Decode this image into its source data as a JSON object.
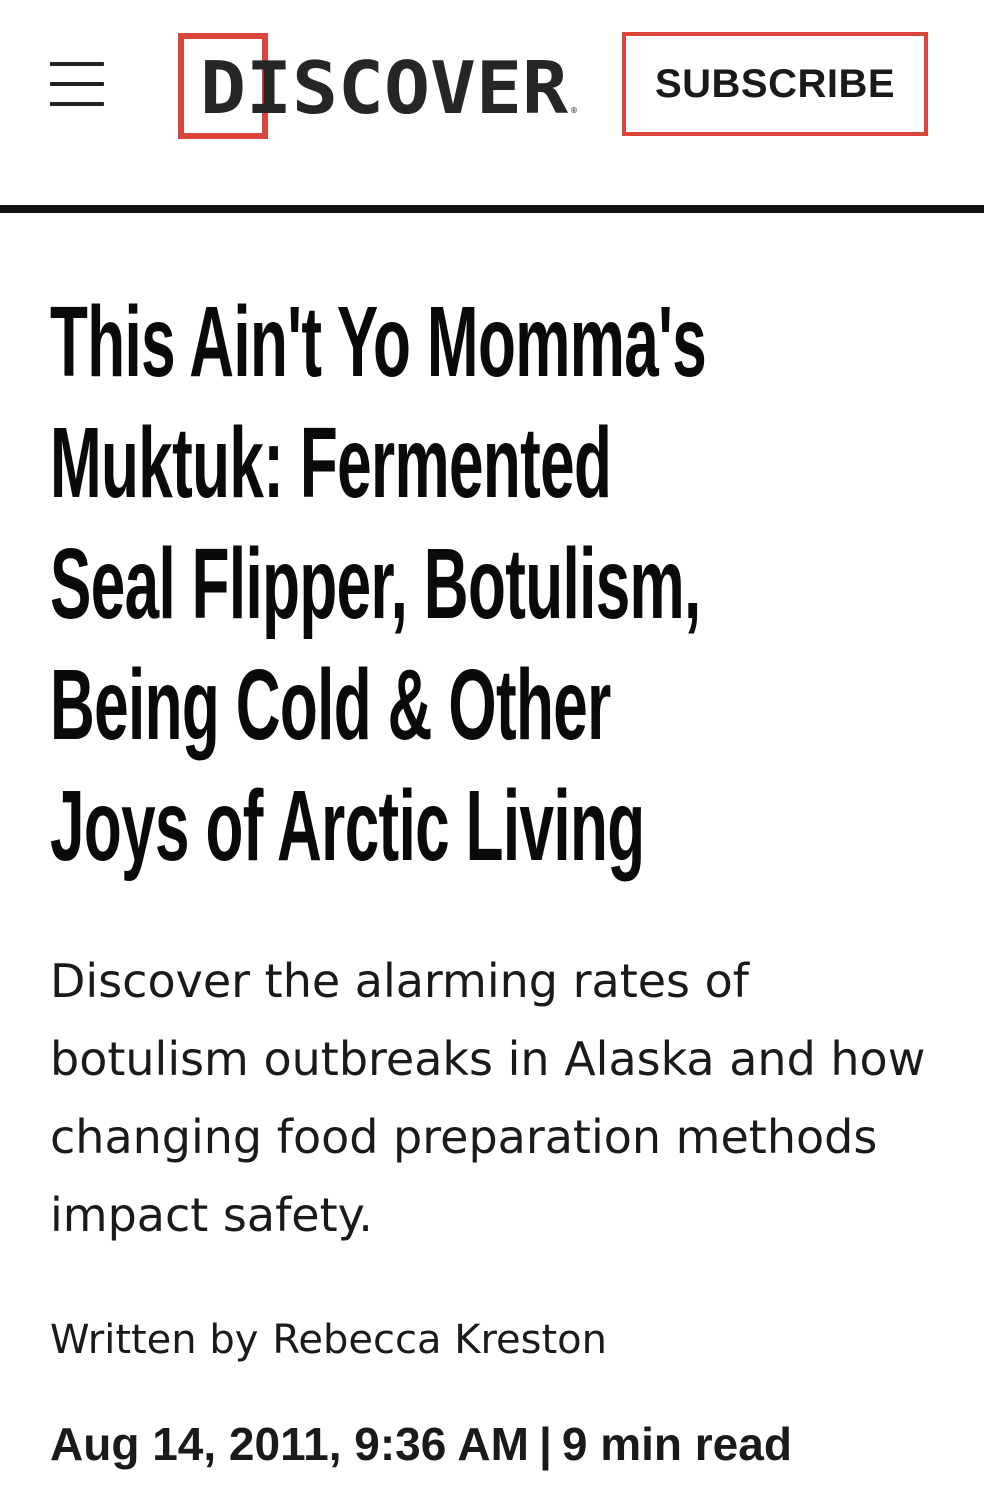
{
  "header": {
    "menu_icon": "hamburger-menu-icon",
    "logo_text": "DISCOVER",
    "subscribe_label": "SUBSCRIBE",
    "accent_color": "#d9443c"
  },
  "article": {
    "title_lines": [
      "This Ain't Yo Momma's",
      "Muktuk: Fermented",
      "Seal Flipper, Botulism,",
      "Being Cold & Other",
      "Joys of Arctic Living"
    ],
    "dek": "Discover the alarming rates of botulism outbreaks in Alaska and how changing food preparation methods impact safety.",
    "byline_prefix": "Written by",
    "author": "Rebecca Kreston",
    "date": "Aug 14, 2011, 9:36 AM",
    "separator": "|",
    "read_time": "9 min read"
  }
}
